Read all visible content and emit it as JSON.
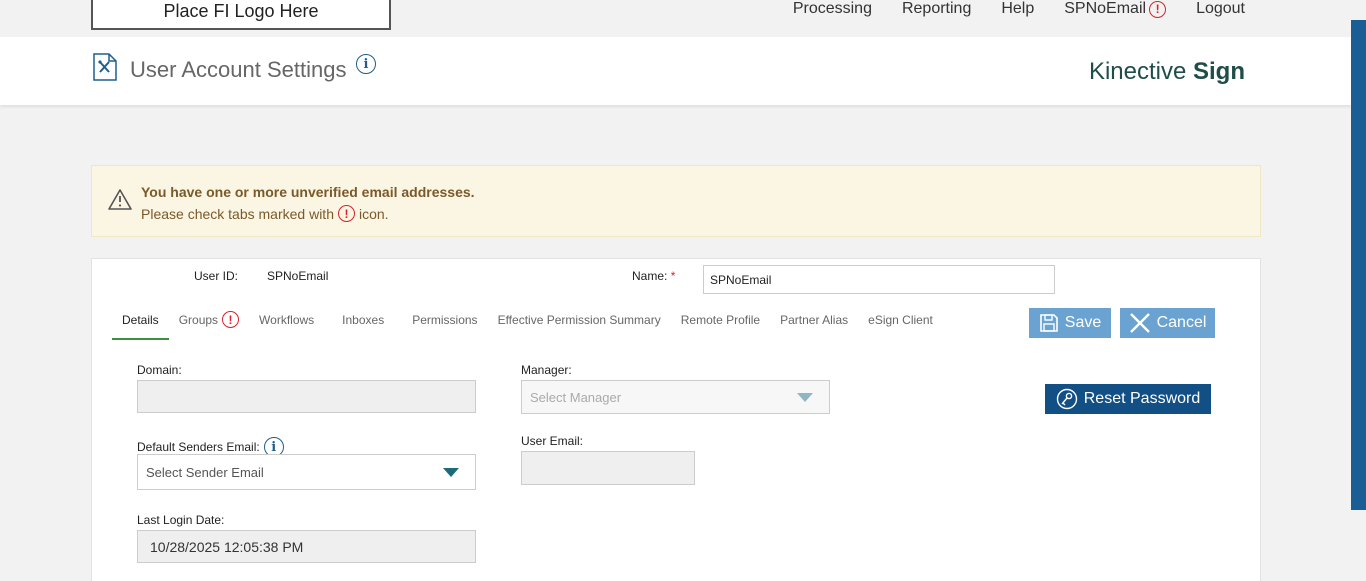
{
  "nav": {
    "logo_text": "Place FI Logo Here",
    "items": [
      "Processing",
      "Reporting",
      "Help",
      "SPNoEmail",
      "Logout"
    ]
  },
  "header": {
    "title": "User Account Settings",
    "brand_light": "Kinective",
    "brand_bold": "Sign"
  },
  "alert": {
    "line1": "You have one or more unverified email addresses.",
    "line2_prefix": "Please check tabs marked with",
    "line2_suffix": "icon."
  },
  "user": {
    "user_id_label": "User ID:",
    "user_id_value": "SPNoEmail",
    "name_label": "Name:",
    "name_required": "*",
    "name_value": "SPNoEmail"
  },
  "tabs": [
    {
      "label": "Details",
      "active": true,
      "warn": false
    },
    {
      "label": "Groups",
      "active": false,
      "warn": true
    },
    {
      "label": "Workflows",
      "active": false,
      "warn": false
    },
    {
      "label": "Inboxes",
      "active": false,
      "warn": false
    },
    {
      "label": "Permissions",
      "active": false,
      "warn": false
    },
    {
      "label": "Effective Permission Summary",
      "active": false,
      "warn": false
    },
    {
      "label": "Remote Profile",
      "active": false,
      "warn": false
    },
    {
      "label": "Partner Alias",
      "active": false,
      "warn": false
    },
    {
      "label": "eSign Client",
      "active": false,
      "warn": false
    }
  ],
  "buttons": {
    "save": "Save",
    "cancel": "Cancel",
    "reset_password": "Reset Password"
  },
  "form": {
    "domain_label": "Domain:",
    "domain_value": "",
    "manager_label": "Manager:",
    "manager_placeholder": "Select Manager",
    "sender_label": "Default Senders Email:",
    "sender_placeholder": "Select Sender Email",
    "user_email_label": "User Email:",
    "user_email_value": "",
    "last_login_label": "Last Login Date:",
    "last_login_value": "10/28/2025 12:05:38 PM"
  },
  "colors": {
    "primary_button": "#6aa3d1",
    "reset_button": "#114f85",
    "warning_red": "#d8232a",
    "active_tab": "#3f8f3f"
  }
}
